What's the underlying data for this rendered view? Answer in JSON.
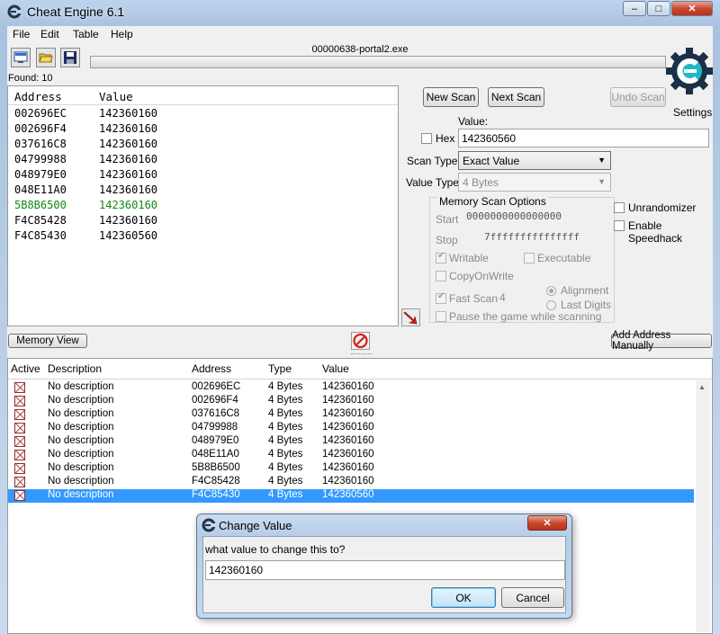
{
  "window": {
    "title": "Cheat Engine 6.1",
    "minimize_label": "–",
    "maximize_label": "□",
    "close_label": "✕"
  },
  "menu": [
    "File",
    "Edit",
    "Table",
    "Help"
  ],
  "toolbar": {
    "process_name": "00000638-portal2.exe",
    "icons": [
      "select-process-icon",
      "open-file-icon",
      "save-icon"
    ],
    "found_label": "Found: 10",
    "settings_label": "Settings"
  },
  "results": {
    "columns": [
      "Address",
      "Value"
    ],
    "rows": [
      {
        "address": "002696EC",
        "value": "142360160",
        "color": "#000000"
      },
      {
        "address": "002696F4",
        "value": "142360160",
        "color": "#000000"
      },
      {
        "address": "037616C8",
        "value": "142360160",
        "color": "#000000"
      },
      {
        "address": "04799988",
        "value": "142360160",
        "color": "#000000"
      },
      {
        "address": "048979E0",
        "value": "142360160",
        "color": "#000000"
      },
      {
        "address": "048E11A0",
        "value": "142360160",
        "color": "#000000"
      },
      {
        "address": "5B8B6500",
        "value": "142360160",
        "color": "#108a10"
      },
      {
        "address": "F4C85428",
        "value": "142360160",
        "color": "#000000"
      },
      {
        "address": "F4C85430",
        "value": "142360560",
        "color": "#000000"
      }
    ]
  },
  "scan": {
    "new_scan": "New Scan",
    "next_scan": "Next Scan",
    "undo_scan": "Undo Scan",
    "value_label": "Value:",
    "hex_label": "Hex",
    "value": "142360560",
    "scan_type_label": "Scan Type",
    "scan_type": "Exact Value",
    "value_type_label": "Value Type",
    "value_type": "4 Bytes",
    "options_title": "Memory Scan Options",
    "start_label": "Start",
    "start_value": "0000000000000000",
    "stop_label": "Stop",
    "stop_value": "7fffffffffffffff",
    "writable": "Writable",
    "executable": "Executable",
    "copy_on_write": "CopyOnWrite",
    "fast_scan": "Fast Scan",
    "fast_scan_value": "4",
    "alignment": "Alignment",
    "last_digits": "Last Digits",
    "pause_game": "Pause the game while scanning",
    "unrandomizer": "Unrandomizer",
    "enable_speedhack": "Enable Speedhack"
  },
  "bottom_buttons": {
    "memory_view": "Memory View",
    "add_address": "Add Address Manually"
  },
  "address_table": {
    "columns": [
      "Active",
      "Description",
      "Address",
      "Type",
      "Value"
    ],
    "rows": [
      {
        "description": "No description",
        "address": "002696EC",
        "type": "4 Bytes",
        "value": "142360160",
        "selected": false
      },
      {
        "description": "No description",
        "address": "002696F4",
        "type": "4 Bytes",
        "value": "142360160",
        "selected": false
      },
      {
        "description": "No description",
        "address": "037616C8",
        "type": "4 Bytes",
        "value": "142360160",
        "selected": false
      },
      {
        "description": "No description",
        "address": "04799988",
        "type": "4 Bytes",
        "value": "142360160",
        "selected": false
      },
      {
        "description": "No description",
        "address": "048979E0",
        "type": "4 Bytes",
        "value": "142360160",
        "selected": false
      },
      {
        "description": "No description",
        "address": "048E11A0",
        "type": "4 Bytes",
        "value": "142360160",
        "selected": false
      },
      {
        "description": "No description",
        "address": "5B8B6500",
        "type": "4 Bytes",
        "value": "142360160",
        "selected": false
      },
      {
        "description": "No description",
        "address": "F4C85428",
        "type": "4 Bytes",
        "value": "142360160",
        "selected": false
      },
      {
        "description": "No description",
        "address": "F4C85430",
        "type": "4 Bytes",
        "value": "142360560",
        "selected": true
      }
    ]
  },
  "dialog": {
    "title": "Change Value",
    "prompt": "what value to change this to?",
    "value": "142360160",
    "ok": "OK",
    "cancel": "Cancel",
    "close_label": "✕"
  },
  "colors": {
    "selection": "#3399ff",
    "highlight_row": "#108a10"
  }
}
